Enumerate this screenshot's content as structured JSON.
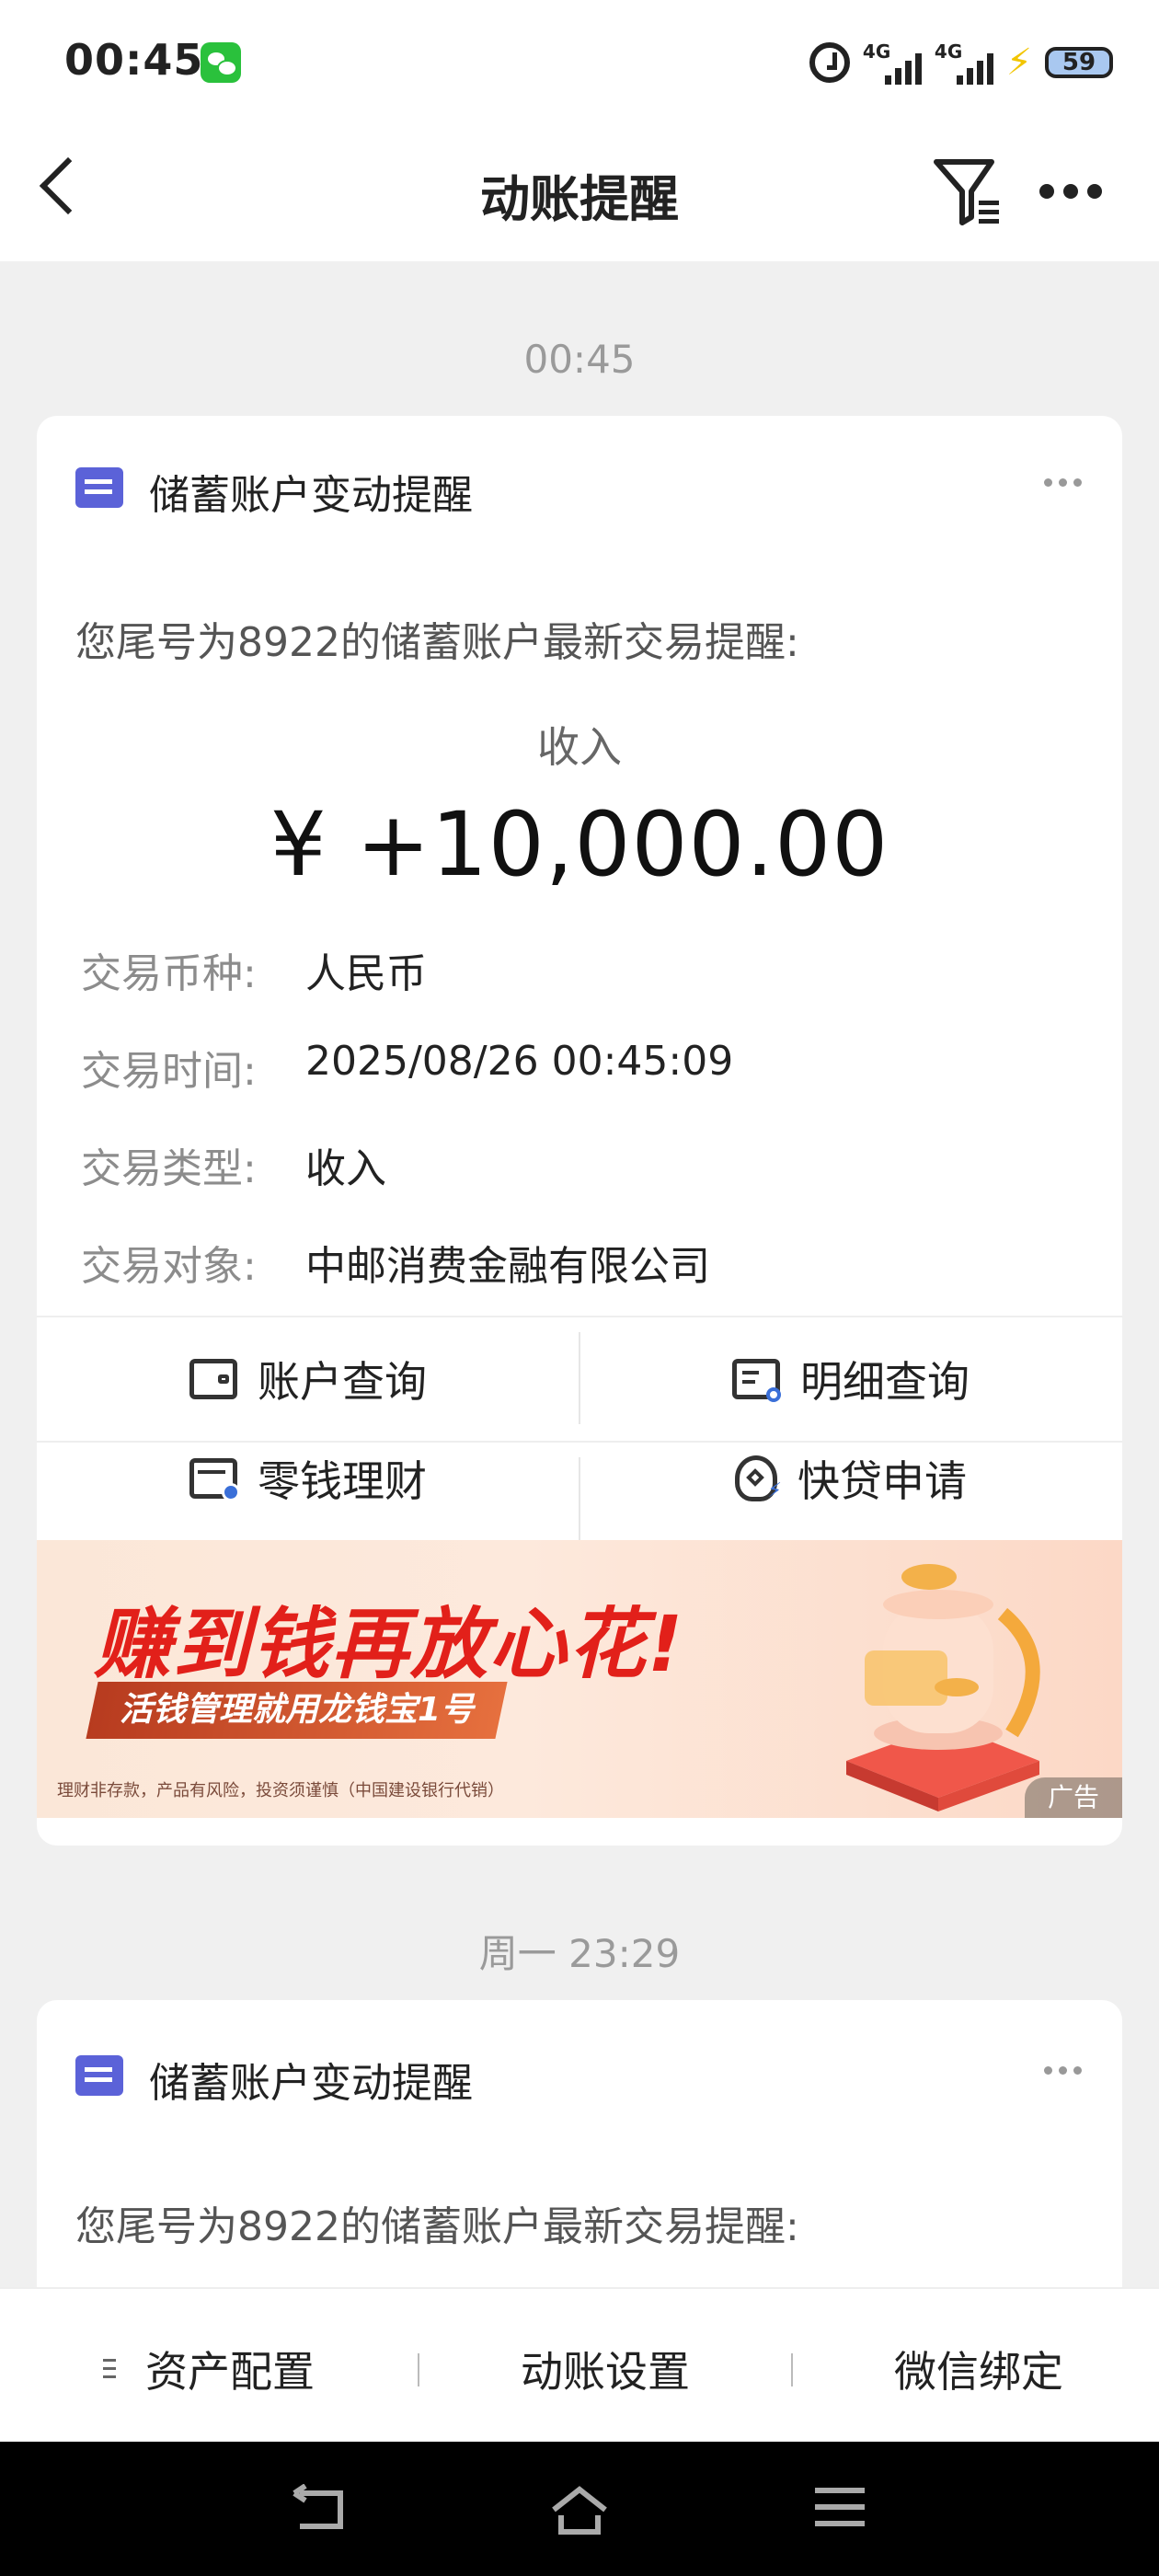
{
  "status_bar": {
    "time": "00:45",
    "network_1": "4G",
    "network_2": "4G",
    "battery": "59"
  },
  "header": {
    "title": "动账提醒"
  },
  "timestamps": [
    "00:45",
    "周一 23:29"
  ],
  "card1": {
    "title": "储蓄账户变动提醒",
    "intro": "您尾号为8922的储蓄账户最新交易提醒:",
    "type_heading": "收入",
    "amount": "¥ +10,000.00",
    "rows": [
      {
        "key": "交易币种:",
        "value": "人民币"
      },
      {
        "key": "交易时间:",
        "value": "2025/08/26 00:45:09"
      },
      {
        "key": "交易类型:",
        "value": "收入"
      },
      {
        "key": "交易对象:",
        "value": "中邮消费金融有限公司"
      }
    ],
    "actions": [
      {
        "label": "账户查询",
        "icon": "wallet-icon"
      },
      {
        "label": "明细查询",
        "icon": "detail-search-icon"
      },
      {
        "label": "零钱理财",
        "icon": "wealth-icon"
      },
      {
        "label": "快贷申请",
        "icon": "loan-bag-icon"
      }
    ],
    "banner": {
      "headline": "赚到钱再放心花!",
      "subline": "活钱管理就用龙钱宝1号",
      "disclaimer": "理财非存款，产品有风险，投资须谨慎（中国建设银行代销）",
      "ad_tag": "广告"
    }
  },
  "card2": {
    "title": "储蓄账户变动提醒",
    "intro": "您尾号为8922的储蓄账户最新交易提醒:"
  },
  "bottom_tabs": [
    "资产配置",
    "动账设置",
    "微信绑定"
  ],
  "colors": {
    "accent_icon": "#5b62d8",
    "banner_red": "#e2201a",
    "wechat_green": "#2ac13c"
  }
}
